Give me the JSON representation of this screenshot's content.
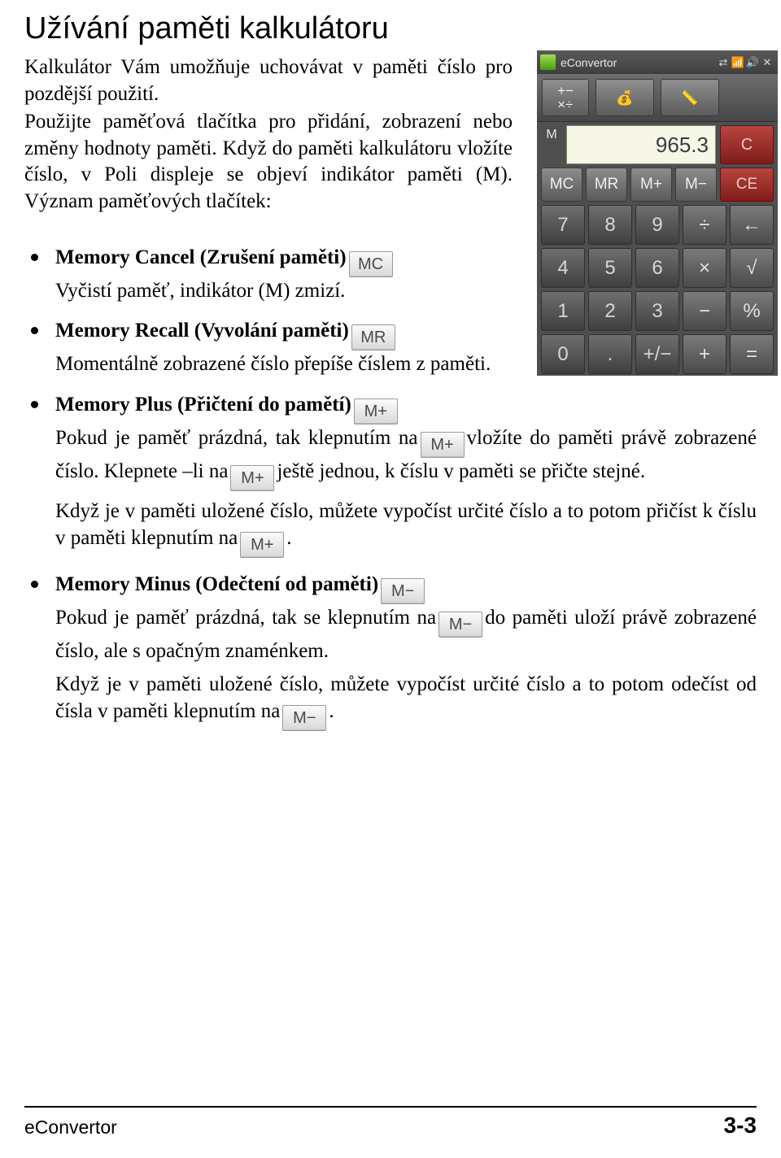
{
  "document": {
    "title": "Užívání paměti kalkulátoru",
    "intro": [
      "Kalkulátor Vám umožňuje uchovávat v paměti číslo pro pozdější použití.",
      "Použijte paměťová tlačítka pro přidání, zobrazení nebo změny hodnoty paměti. Když do paměti kalkulátoru vložíte číslo, v Poli displeje se objeví indikátor paměti (M). Význam paměťových tlačítek:"
    ]
  },
  "calculator": {
    "window_title": "eConvertor",
    "title_icons": [
      "swap-icon",
      "signal-icon",
      "volume-icon",
      "close-icon"
    ],
    "toolbar_buttons": [
      "+ −\n× ÷",
      "money-icon",
      "ruler-icon"
    ],
    "memory_indicator": "M",
    "display_value": "965.3",
    "clear_label": "C",
    "memory_buttons": [
      "MC",
      "MR",
      "M+",
      "M−"
    ],
    "ce_label": "CE",
    "keys": [
      [
        "7",
        "8",
        "9",
        "÷",
        "←"
      ],
      [
        "4",
        "5",
        "6",
        "×",
        "√"
      ],
      [
        "1",
        "2",
        "3",
        "−",
        "%"
      ],
      [
        "0",
        ".",
        "+/−",
        "+",
        "="
      ]
    ]
  },
  "items": [
    {
      "heading": "Memory Cancel (Zrušení paměti)",
      "key": "MC",
      "lines": [
        "Vyčistí paměť, indikátor (M) zmizí."
      ]
    },
    {
      "heading": "Memory Recall (Vyvolání paměti)",
      "key": "MR",
      "lines": [
        "Momentálně zobrazené číslo přepíše číslem z paměti."
      ]
    },
    {
      "heading": "Memory Plus (Přičtení do pamětí)",
      "key": "M+",
      "p1_a": "Pokud je paměť prázdná, tak klepnutím na",
      "p1_key": "M+",
      "p1_b": "vložíte do paměti právě zobrazené číslo. Klepnete –li na",
      "p1_key2": "M+",
      "p1_c": "ještě jednou, k číslu v paměti se přičte stejné.",
      "p2_a": "Když je v paměti uložené číslo, můžete vypočíst určité číslo a to potom přičíst k číslu v paměti klepnutím na",
      "p2_key": "M+",
      "p2_b": "."
    },
    {
      "heading": "Memory Minus (Odečtení od paměti)",
      "key": "M−",
      "p1_a": "Pokud je paměť prázdná, tak se  klepnutím na",
      "p1_key": "M−",
      "p1_b": "do paměti uloží právě zobrazené číslo, ale s opačným znaménkem.",
      "p2_a": "Když je v paměti uložené číslo, můžete vypočíst určité číslo a to potom odečíst od čísla v paměti klepnutím na",
      "p2_key": "M−",
      "p2_b": "."
    }
  ],
  "footer": {
    "left": "eConvertor",
    "right": "3-3"
  }
}
